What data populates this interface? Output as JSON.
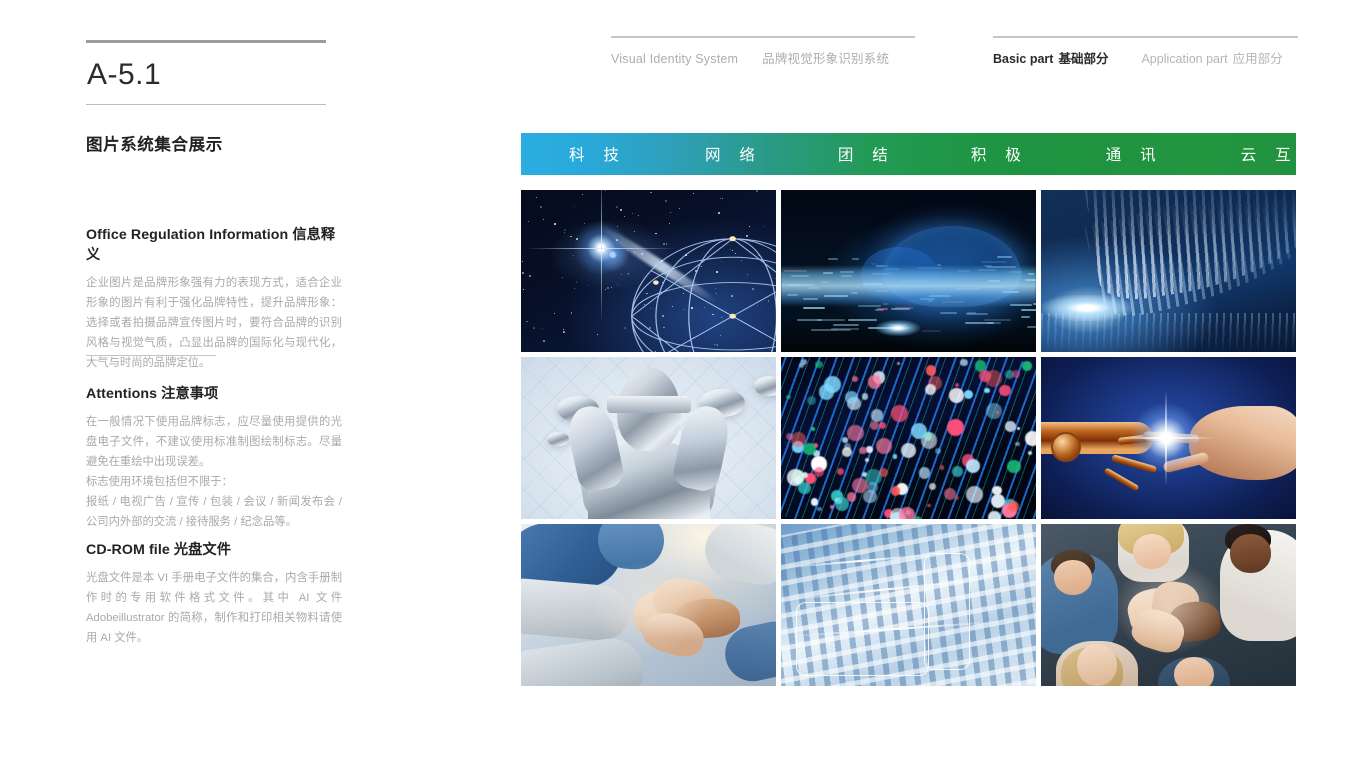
{
  "header": {
    "vis_en": "Visual Identity System",
    "vis_cn": "品牌视觉形象识别系统",
    "basic_en": "Basic part",
    "basic_cn": "基础部分",
    "application_en": "Application part",
    "application_cn": "应用部分"
  },
  "left": {
    "page_code": "A-5.1",
    "section_title": "图片系统集合展示",
    "blocks": [
      {
        "heading_en": "Office Regulation Information",
        "heading_cn": "信息释义",
        "body": "企业图片是品牌形象强有力的表现方式，适合企业形象的图片有利于强化品牌特性，提升品牌形象：选择或者拍摄品牌宣传图片时，要符合品牌的识别风格与视觉气质，凸显出品牌的国际化与现代化，大气与时尚的品牌定位。"
      },
      {
        "heading_en": "Attentions",
        "heading_cn": "注意事项",
        "body": "在一般情况下使用品牌标志，应尽量使用提供的光盘电子文件，不建议使用标准制图绘制标志。尽量避免在重绘中出现误差。",
        "body2": "标志使用环境包括但不限于：",
        "body3": "报纸 / 电视广告 / 宣传 / 包装 / 会议 / 新闻发布会 / 公司内外部的交流 / 接待服务 / 纪念品等。"
      },
      {
        "heading_en": "CD-ROM file",
        "heading_cn": "光盘文件",
        "body": "光盘文件是本 VI 手册电子文件的集合，内含手册制作时的专用软件格式文件。其中 AI 文件 Adobeillustrator 的简称，制作和打印相关物料请使用 AI 文件。"
      }
    ]
  },
  "keyword_bar": {
    "gradient_start": "#2aaee2",
    "gradient_end": "#219240",
    "keywords": [
      "科 技",
      "网 络",
      "团 结",
      "积 极",
      "通 讯",
      "云 互 联"
    ]
  },
  "image_grid": {
    "columns": 3,
    "rows": 3,
    "images": [
      {
        "name": "starfield-network-globe",
        "alt": "星空中的蓝色网络地球光点连线"
      },
      {
        "name": "digital-cloud",
        "alt": "蓝色数字云计算数据流"
      },
      {
        "name": "binary-data-tunnel",
        "alt": "二进制数据流隧道"
      },
      {
        "name": "silver-android-woman",
        "alt": "白色背景银色未来机器人女性"
      },
      {
        "name": "fiber-optic-lights",
        "alt": "光纤线缆彩色光斑"
      },
      {
        "name": "robot-human-hands",
        "alt": "机械手与人手指尖相触"
      },
      {
        "name": "team-hands-stack",
        "alt": "团队叠手合作"
      },
      {
        "name": "blue-binary-circuit",
        "alt": "淡蓝色二进制电路抽象"
      },
      {
        "name": "team-high-five",
        "alt": "多元团队俯视击掌"
      }
    ]
  }
}
